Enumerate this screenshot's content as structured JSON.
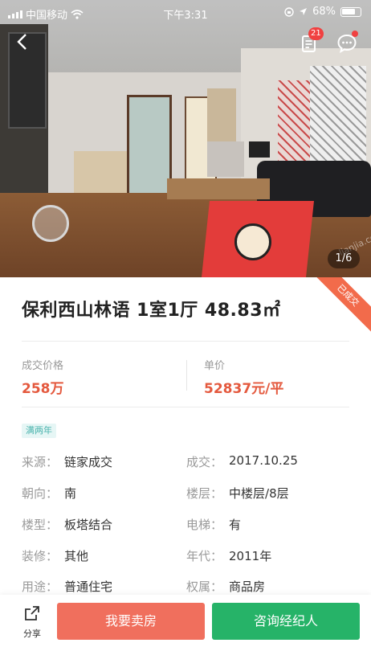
{
  "status_bar": {
    "carrier": "中国移动",
    "time": "下午3:31",
    "battery": "68%"
  },
  "gallery": {
    "counter": "1/6",
    "watermark": "lianjia.com"
  },
  "header": {
    "notification_count": "21"
  },
  "sold_ribbon": "已成交",
  "listing": {
    "title": "保利西山林语 1室1厅 48.83㎡"
  },
  "prices": {
    "deal_label": "成交价格",
    "deal_value": "258万",
    "unit_label": "单价",
    "unit_value": "52837元/平"
  },
  "tag": "满两年",
  "details": [
    {
      "k": "来源：",
      "v": "链家成交"
    },
    {
      "k": "成交：",
      "v": "2017.10.25"
    },
    {
      "k": "朝向：",
      "v": "南"
    },
    {
      "k": "楼层：",
      "v": "中楼层/8层"
    },
    {
      "k": "楼型：",
      "v": "板塔结合"
    },
    {
      "k": "电梯：",
      "v": "有"
    },
    {
      "k": "装修：",
      "v": "其他"
    },
    {
      "k": "年代：",
      "v": "2011年"
    },
    {
      "k": "用途：",
      "v": "普通住宅"
    },
    {
      "k": "权属：",
      "v": "商品房"
    }
  ],
  "bottom_bar": {
    "share_label": "分享",
    "sell_label": "我要卖房",
    "agent_label": "咨询经纪人"
  },
  "colors": {
    "price": "#e4593e",
    "sell_button": "#f06f5d",
    "agent_button": "#26b368",
    "tag_bg": "#e6f6f5",
    "badge": "#f04141"
  }
}
